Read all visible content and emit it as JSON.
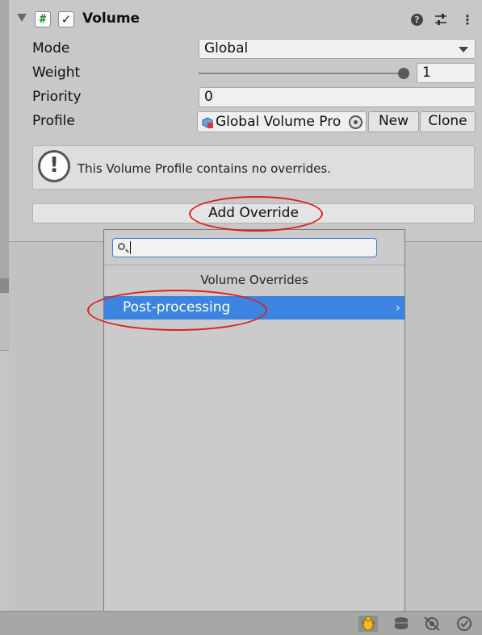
{
  "component": {
    "title": "Volume",
    "enabled": true,
    "script_icon_glyph": "#"
  },
  "fields": {
    "mode_label": "Mode",
    "mode_value": "Global",
    "weight_label": "Weight",
    "weight_value": "1",
    "priority_label": "Priority",
    "priority_value": "0",
    "profile_label": "Profile",
    "profile_value": "Global Volume Pro"
  },
  "buttons": {
    "new_label": "New",
    "clone_label": "Clone",
    "add_override_label": "Add Override"
  },
  "helpbox": {
    "text": "This Volume Profile contains no overrides."
  },
  "popup": {
    "search_value": "",
    "title": "Volume Overrides",
    "items": [
      {
        "label": "Post-processing",
        "has_submenu": true,
        "selected": true
      }
    ]
  },
  "colors": {
    "accent": "#3d84e0",
    "annotation": "#dd1f1f"
  }
}
